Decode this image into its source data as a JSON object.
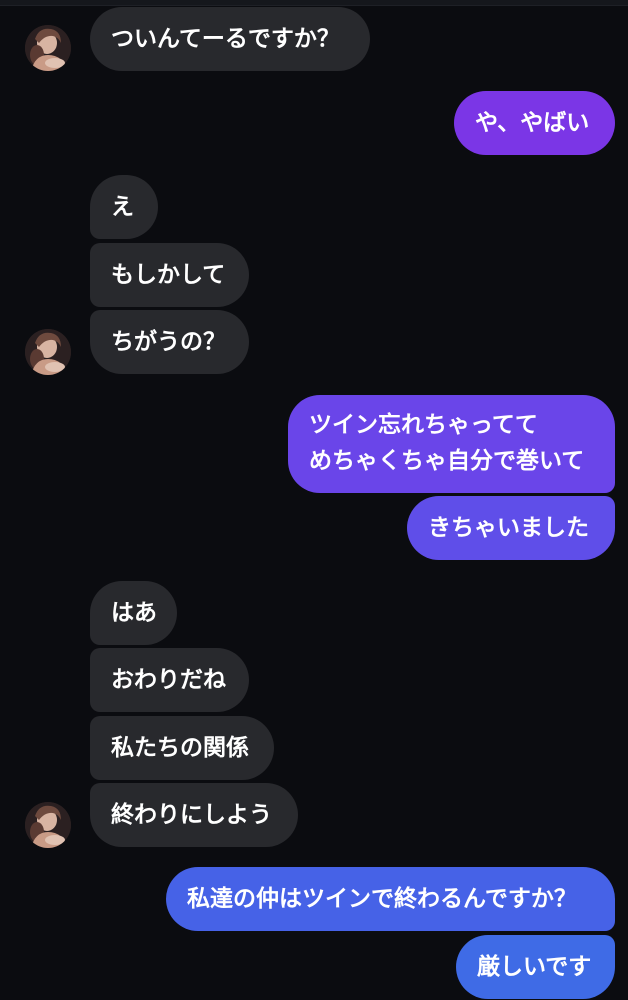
{
  "messages": [
    {
      "side": "left",
      "text": "ついんてーるですか？",
      "avatar": true
    },
    {
      "side": "right",
      "text": "や、やばい",
      "color": "#7b36e6"
    },
    {
      "side": "left",
      "text": "え"
    },
    {
      "side": "left",
      "text": "もしかして"
    },
    {
      "side": "left",
      "text": "ちがうの？",
      "avatar": true
    },
    {
      "side": "right",
      "lines": [
        "ツイン忘れちゃってて",
        "めちゃくちゃ自分で巻いて"
      ],
      "color": "#6a45e9"
    },
    {
      "side": "right",
      "text": "きちゃいました",
      "color": "#5f4ee9"
    },
    {
      "side": "left",
      "text": "はあ"
    },
    {
      "side": "left",
      "text": "おわりだね"
    },
    {
      "side": "left",
      "text": "私たちの関係"
    },
    {
      "side": "left",
      "text": "終わりにしよう",
      "avatar": true
    },
    {
      "side": "right",
      "text": "私達の仲はツインで終わるんですか？",
      "color": "#4662e7"
    },
    {
      "side": "right",
      "text": "厳しいです",
      "color": "#3f6be6"
    }
  ],
  "avatar_icon": "profile-photo"
}
